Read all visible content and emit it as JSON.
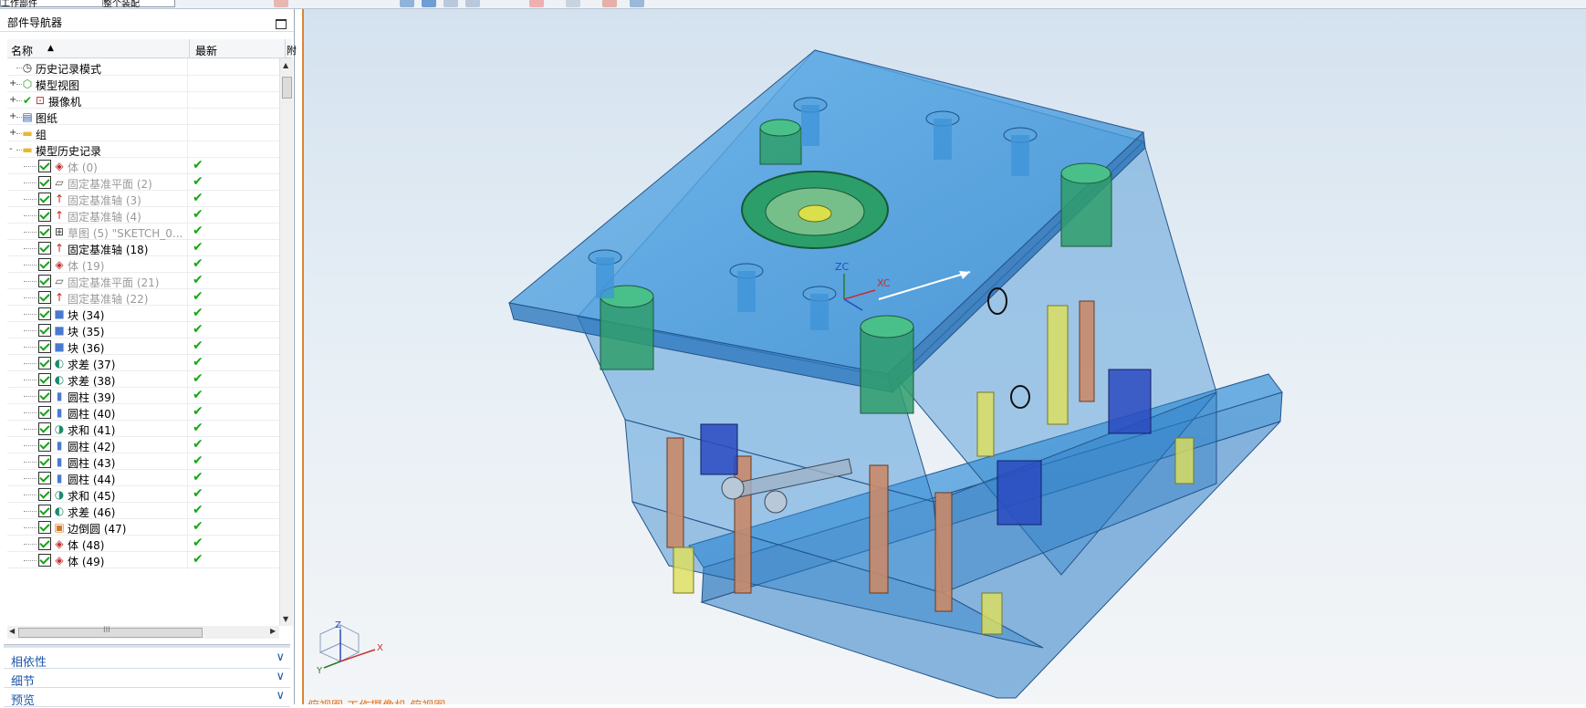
{
  "toolbar": {
    "combo_left": "工作部件",
    "combo_right": "整个装配"
  },
  "navigator": {
    "title": "部件导航器",
    "columns": {
      "name": "名称",
      "latest": "最新",
      "third": "附"
    },
    "rows": [
      {
        "label": "历史记录模式",
        "level": 0,
        "expander": "",
        "icon": "clock-icon",
        "checkbox": false,
        "status": "",
        "dim": false
      },
      {
        "label": "模型视图",
        "level": 0,
        "expander": "+",
        "icon": "model-view-icon",
        "checkbox": false,
        "status": "",
        "dim": false
      },
      {
        "label": "摄像机",
        "level": 0,
        "expander": "+",
        "icon": "camera-icon",
        "checkbox": false,
        "status": "",
        "dim": false,
        "pre_check": true
      },
      {
        "label": "图纸",
        "level": 0,
        "expander": "+",
        "icon": "drawing-icon",
        "checkbox": false,
        "status": "",
        "dim": false
      },
      {
        "label": "组",
        "level": 0,
        "expander": "+",
        "icon": "folder-icon",
        "checkbox": false,
        "status": "",
        "dim": false
      },
      {
        "label": "模型历史记录",
        "level": 0,
        "expander": "-",
        "icon": "folder-open-icon",
        "checkbox": false,
        "status": "",
        "dim": false
      },
      {
        "label": "体 (0)",
        "level": 1,
        "icon": "body-icon",
        "checkbox": true,
        "status": "ok",
        "dim": true
      },
      {
        "label": "固定基准平面 (2)",
        "level": 1,
        "icon": "datum-plane-icon",
        "checkbox": true,
        "status": "ok",
        "dim": true
      },
      {
        "label": "固定基准轴 (3)",
        "level": 1,
        "icon": "datum-axis-icon",
        "checkbox": true,
        "status": "ok",
        "dim": true
      },
      {
        "label": "固定基准轴 (4)",
        "level": 1,
        "icon": "datum-axis-icon",
        "checkbox": true,
        "status": "ok",
        "dim": true
      },
      {
        "label": "草图 (5) \"SKETCH_0...",
        "level": 1,
        "icon": "sketch-icon",
        "checkbox": true,
        "status": "ok",
        "dim": true
      },
      {
        "label": "固定基准轴 (18)",
        "level": 1,
        "icon": "datum-axis-icon",
        "checkbox": true,
        "status": "ok",
        "dim": false
      },
      {
        "label": "体 (19)",
        "level": 1,
        "icon": "body-icon",
        "checkbox": true,
        "status": "ok",
        "dim": true
      },
      {
        "label": "固定基准平面 (21)",
        "level": 1,
        "icon": "datum-plane-icon",
        "checkbox": true,
        "status": "ok",
        "dim": true
      },
      {
        "label": "固定基准轴 (22)",
        "level": 1,
        "icon": "datum-axis-icon",
        "checkbox": true,
        "status": "ok",
        "dim": true
      },
      {
        "label": "块 (34)",
        "level": 1,
        "icon": "block-icon",
        "checkbox": true,
        "status": "ok",
        "dim": false
      },
      {
        "label": "块 (35)",
        "level": 1,
        "icon": "block-icon",
        "checkbox": true,
        "status": "ok",
        "dim": false
      },
      {
        "label": "块 (36)",
        "level": 1,
        "icon": "block-icon",
        "checkbox": true,
        "status": "ok",
        "dim": false
      },
      {
        "label": "求差 (37)",
        "level": 1,
        "icon": "subtract-icon",
        "checkbox": true,
        "status": "ok",
        "dim": false
      },
      {
        "label": "求差 (38)",
        "level": 1,
        "icon": "subtract-icon",
        "checkbox": true,
        "status": "ok",
        "dim": false
      },
      {
        "label": "圆柱 (39)",
        "level": 1,
        "icon": "cylinder-icon",
        "checkbox": true,
        "status": "ok",
        "dim": false
      },
      {
        "label": "圆柱 (40)",
        "level": 1,
        "icon": "cylinder-icon",
        "checkbox": true,
        "status": "ok",
        "dim": false
      },
      {
        "label": "求和 (41)",
        "level": 1,
        "icon": "unite-icon",
        "checkbox": true,
        "status": "ok",
        "dim": false
      },
      {
        "label": "圆柱 (42)",
        "level": 1,
        "icon": "cylinder-icon",
        "checkbox": true,
        "status": "ok",
        "dim": false
      },
      {
        "label": "圆柱 (43)",
        "level": 1,
        "icon": "cylinder-icon",
        "checkbox": true,
        "status": "ok",
        "dim": false
      },
      {
        "label": "圆柱 (44)",
        "level": 1,
        "icon": "cylinder-icon",
        "checkbox": true,
        "status": "ok",
        "dim": false
      },
      {
        "label": "求和 (45)",
        "level": 1,
        "icon": "unite-icon",
        "checkbox": true,
        "status": "ok",
        "dim": false
      },
      {
        "label": "求差 (46)",
        "level": 1,
        "icon": "subtract-icon",
        "checkbox": true,
        "status": "ok",
        "dim": false
      },
      {
        "label": "边倒圆 (47)",
        "level": 1,
        "icon": "edge-blend-icon",
        "checkbox": true,
        "status": "ok",
        "dim": false
      },
      {
        "label": "体 (48)",
        "level": 1,
        "icon": "body-icon",
        "checkbox": true,
        "status": "ok",
        "dim": false
      },
      {
        "label": "体 (49)",
        "level": 1,
        "icon": "body-icon",
        "checkbox": true,
        "status": "ok",
        "dim": false
      }
    ],
    "hscroll_label": "III",
    "panels": [
      "相依性",
      "细节",
      "预览"
    ]
  },
  "viewport": {
    "axis_labels": {
      "zc": "ZC",
      "xc": "XC",
      "z": "Z",
      "x": "X",
      "y": "Y"
    },
    "status_text": "俯视图 工作摄像机 俯视图"
  },
  "colors": {
    "plate": "#3b8fd6",
    "ring": "#2c9e6a",
    "accent_orange": "#d98536",
    "status_green": "#18a818"
  }
}
